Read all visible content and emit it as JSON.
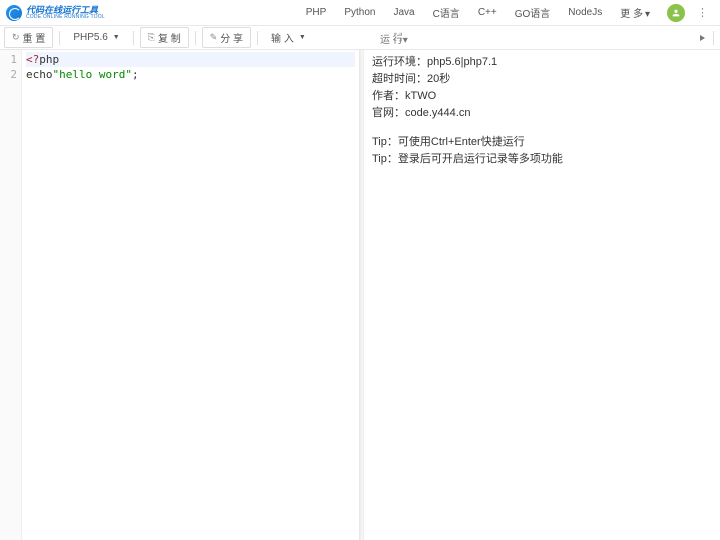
{
  "logo": {
    "cn": "代码在线运行工具",
    "en": "CODE ONLINE RUNNING TOOL"
  },
  "nav": {
    "langs": [
      "PHP",
      "Python",
      "Java",
      "C语言",
      "C++",
      "GO语言",
      "NodeJs"
    ],
    "more": "更 多"
  },
  "toolbar": {
    "reset": "重 置",
    "version": "PHP5.6",
    "copy": "复 制",
    "share": "分 享",
    "input": "输 入",
    "run": "运 行"
  },
  "code": {
    "line1_a": "<?",
    "line1_b": "php",
    "line2_a": "echo",
    "line2_b": "\"hello word\"",
    "line2_c": ";"
  },
  "gutter": {
    "l1": "1",
    "l2": "2"
  },
  "output": {
    "env_label": "运行环境：",
    "env_val": "php5.6|php7.1",
    "timeout_label": "超时时间：",
    "timeout_val": "20秒",
    "author_label": "作者：",
    "author_val": "kTWO",
    "site_label": "官网：",
    "site_val": "code.y444.cn",
    "tip1_label": "Tip：",
    "tip1_val": "可使用Ctrl+Enter快捷运行",
    "tip2_label": "Tip：",
    "tip2_val": "登录后可开启运行记录等多项功能"
  }
}
